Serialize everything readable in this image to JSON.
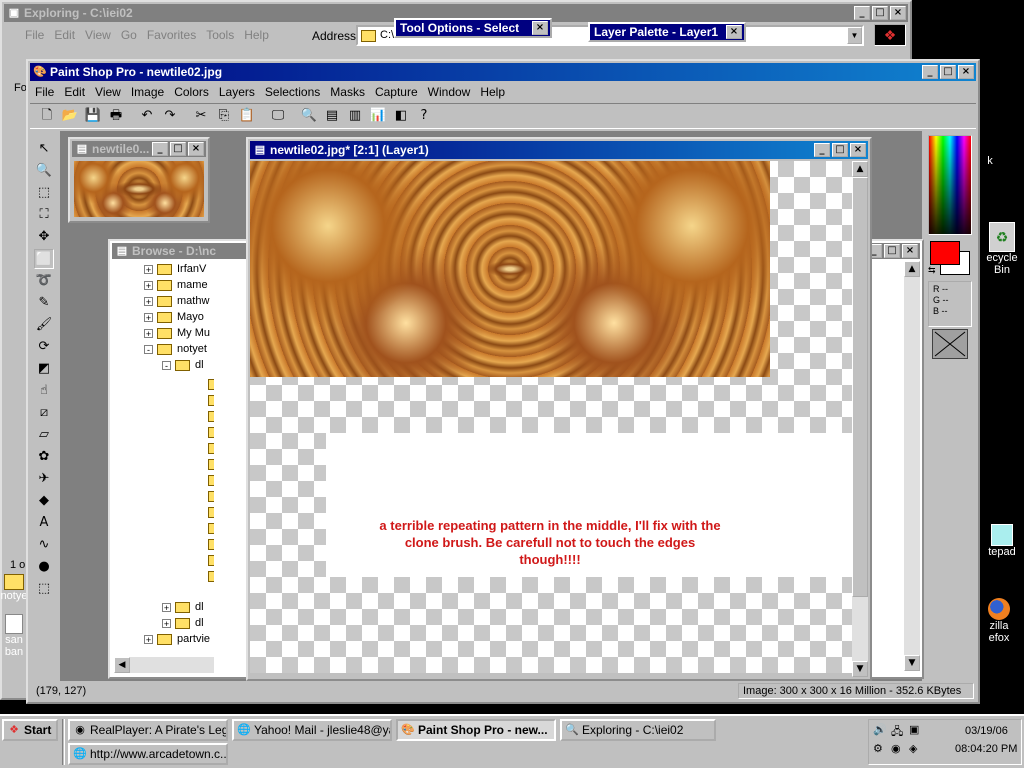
{
  "explorer": {
    "title": "Exploring - C:\\iei02",
    "menu": [
      "File",
      "Edit",
      "View",
      "Go",
      "Favorites",
      "Tools",
      "Help"
    ],
    "address_label": "Address",
    "address_value": "C:\\iei02",
    "side_text": "Fo",
    "status_fragment": "1 ol"
  },
  "tool_options": {
    "title": "Tool Options - Select"
  },
  "layer_palette": {
    "title": "Layer Palette - Layer1"
  },
  "psp": {
    "title": "Paint Shop Pro - newtile02.jpg",
    "menu": [
      "File",
      "Edit",
      "View",
      "Image",
      "Colors",
      "Layers",
      "Selections",
      "Masks",
      "Capture",
      "Window",
      "Help"
    ],
    "toolbar_icons": [
      "new-icon",
      "open-icon",
      "save-icon",
      "print-icon",
      "undo-icon",
      "redo-icon",
      "cut-icon",
      "copy-icon",
      "paste-icon",
      "full-screen-icon",
      "zoom-icon",
      "toolbar-toggle-icon",
      "color-palette-icon",
      "histogram-icon",
      "layer-palette-icon",
      "help-icon"
    ],
    "tools": [
      "arrow-tool-icon",
      "zoom-tool-icon",
      "deform-tool-icon",
      "crop-tool-icon",
      "mover-tool-icon",
      "selection-tool-icon",
      "freehand-tool-icon",
      "dropper-tool-icon",
      "paintbrush-tool-icon",
      "clone-brush-tool-icon",
      "color-replacer-tool-icon",
      "retouch-tool-icon",
      "scratch-remover-tool-icon",
      "eraser-tool-icon",
      "picture-tube-tool-icon",
      "airbrush-tool-icon",
      "flood-fill-tool-icon",
      "text-tool-icon",
      "draw-tool-icon",
      "preset-shapes-tool-icon",
      "object-selector-tool-icon"
    ],
    "overview_title": "newtile0...",
    "image_window_title": "newtile02.jpg* [2:1] (Layer1)",
    "browse_title": "Browse - D:\\nc",
    "tree": [
      {
        "label": "IrfanV",
        "expander": "+",
        "indent": 0
      },
      {
        "label": "mame",
        "expander": "+",
        "indent": 0
      },
      {
        "label": "mathw",
        "expander": "+",
        "indent": 0
      },
      {
        "label": "Mayo",
        "expander": "+",
        "indent": 0
      },
      {
        "label": "My Mu",
        "expander": "+",
        "indent": 0
      },
      {
        "label": "notyet",
        "expander": "-",
        "indent": 0
      },
      {
        "label": "dl",
        "expander": "-",
        "indent": 1
      },
      {
        "label": "dl",
        "expander": "+",
        "indent": 1
      },
      {
        "label": "dl",
        "expander": "+",
        "indent": 1
      },
      {
        "label": "partvie",
        "expander": "+",
        "indent": 0
      }
    ],
    "annotation": "a terrible repeating pattern in the middle, I'll fix with the clone brush.  Be carefull not to touch the edges though!!!!",
    "color_panel": {
      "r_label": "R --",
      "g_label": "G --",
      "b_label": "B --",
      "foreground": "#ff0000",
      "background": "#ffffff"
    },
    "status_coords": "(179, 127)",
    "status_image": "Image:  300 x 300 x 16 Million - 352.6 KBytes"
  },
  "desktop": {
    "icons": [
      {
        "label": "notye",
        "icon": "folder-icon"
      },
      {
        "label": "san\nban",
        "icon": "document-icon"
      },
      {
        "label": "ecycle\nBin",
        "icon": "recycle-bin-icon"
      },
      {
        "label": "tepad",
        "icon": "notepad-icon"
      },
      {
        "label": "zilla\nefox",
        "icon": "firefox-icon"
      },
      {
        "label": "k",
        "icon": "shortcut-icon"
      }
    ]
  },
  "taskbar": {
    "start_label": "Start",
    "buttons": [
      {
        "label": "RealPlayer: A Pirate's Leg...",
        "icon": "realplayer-icon",
        "pressed": false
      },
      {
        "label": "Yahoo! Mail - jleslie48@ya...",
        "icon": "browser-icon",
        "pressed": false
      },
      {
        "label": "Paint Shop Pro - new...",
        "icon": "paintshop-icon",
        "pressed": true
      },
      {
        "label": "Exploring - C:\\iei02",
        "icon": "explorer-icon",
        "pressed": false
      },
      {
        "label": "http://www.arcadetown.c...",
        "icon": "browser-icon",
        "pressed": false
      }
    ],
    "date": "03/19/06",
    "time": "08:04:20 PM"
  }
}
